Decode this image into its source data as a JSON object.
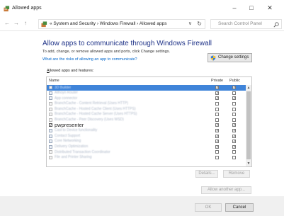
{
  "window": {
    "title": "Allowed apps",
    "minimize": "–",
    "maximize": "□",
    "close": "✕"
  },
  "address_bar": {
    "back": "←",
    "forward": "→",
    "up": "↑",
    "path": "« System and Security  ›  Windows Firewall  ›  Allowed apps",
    "dropdown": "∨",
    "refresh": "↻",
    "search_placeholder": "Search Control Panel",
    "search_icon": "magnifier-icon"
  },
  "page": {
    "heading": "Allow apps to communicate through Windows Firewall",
    "subtext": "To add, change, or remove allowed apps and ports, click Change settings.",
    "risk_link": "What are the risks of allowing an app to communicate?",
    "change_settings": "Change settings",
    "group_label_prefix": "A",
    "group_label_rest": "llowed apps and features:"
  },
  "list": {
    "columns": {
      "name": "Name",
      "private": "Private",
      "public": "Public"
    },
    "scroll_up": "▲",
    "scroll_down": "▼",
    "rows": [
      {
        "label": "3D Builder",
        "enabled": true,
        "private": true,
        "public": true,
        "selected": true,
        "clear": false
      },
      {
        "label": "Allhoyn Router",
        "enabled": true,
        "private": true,
        "public": false,
        "selected": false,
        "clear": false
      },
      {
        "label": "App connector",
        "enabled": true,
        "private": true,
        "public": true,
        "selected": false,
        "clear": false
      },
      {
        "label": "BranchCache - Content Retrieval (Uses HTTP)",
        "enabled": false,
        "private": false,
        "public": false,
        "selected": false,
        "clear": false
      },
      {
        "label": "BranchCache - Hosted Cache Client (Uses HTTPS)",
        "enabled": false,
        "private": false,
        "public": false,
        "selected": false,
        "clear": false
      },
      {
        "label": "BranchCache - Hosted Cache Server (Uses HTTPS)",
        "enabled": false,
        "private": false,
        "public": false,
        "selected": false,
        "clear": false
      },
      {
        "label": "BranchCache - Peer Discovery (Uses WSD)",
        "enabled": false,
        "private": false,
        "public": false,
        "selected": false,
        "clear": false
      },
      {
        "label": "pwpresenter",
        "enabled": true,
        "private": true,
        "public": true,
        "selected": false,
        "clear": true
      },
      {
        "label": "Cast to Device functionality",
        "enabled": true,
        "private": true,
        "public": true,
        "selected": false,
        "clear": false
      },
      {
        "label": "Contact Support",
        "enabled": true,
        "private": true,
        "public": true,
        "selected": false,
        "clear": false
      },
      {
        "label": "Core Networking",
        "enabled": true,
        "private": true,
        "public": true,
        "selected": false,
        "clear": false
      },
      {
        "label": "Delivery Optimization",
        "enabled": true,
        "private": true,
        "public": true,
        "selected": false,
        "clear": false
      },
      {
        "label": "Distributed Transaction Coordinator",
        "enabled": false,
        "private": false,
        "public": false,
        "selected": false,
        "clear": false
      },
      {
        "label": "File and Printer Sharing",
        "enabled": false,
        "private": false,
        "public": false,
        "selected": false,
        "clear": false
      }
    ]
  },
  "buttons": {
    "details": "Details...",
    "remove": "Remove",
    "allow_another": "Allow another app...",
    "ok": "OK",
    "cancel": "Cancel"
  },
  "colors": {
    "heading": "#1e3287",
    "link": "#0066cc",
    "selection": "#3f84d9"
  }
}
